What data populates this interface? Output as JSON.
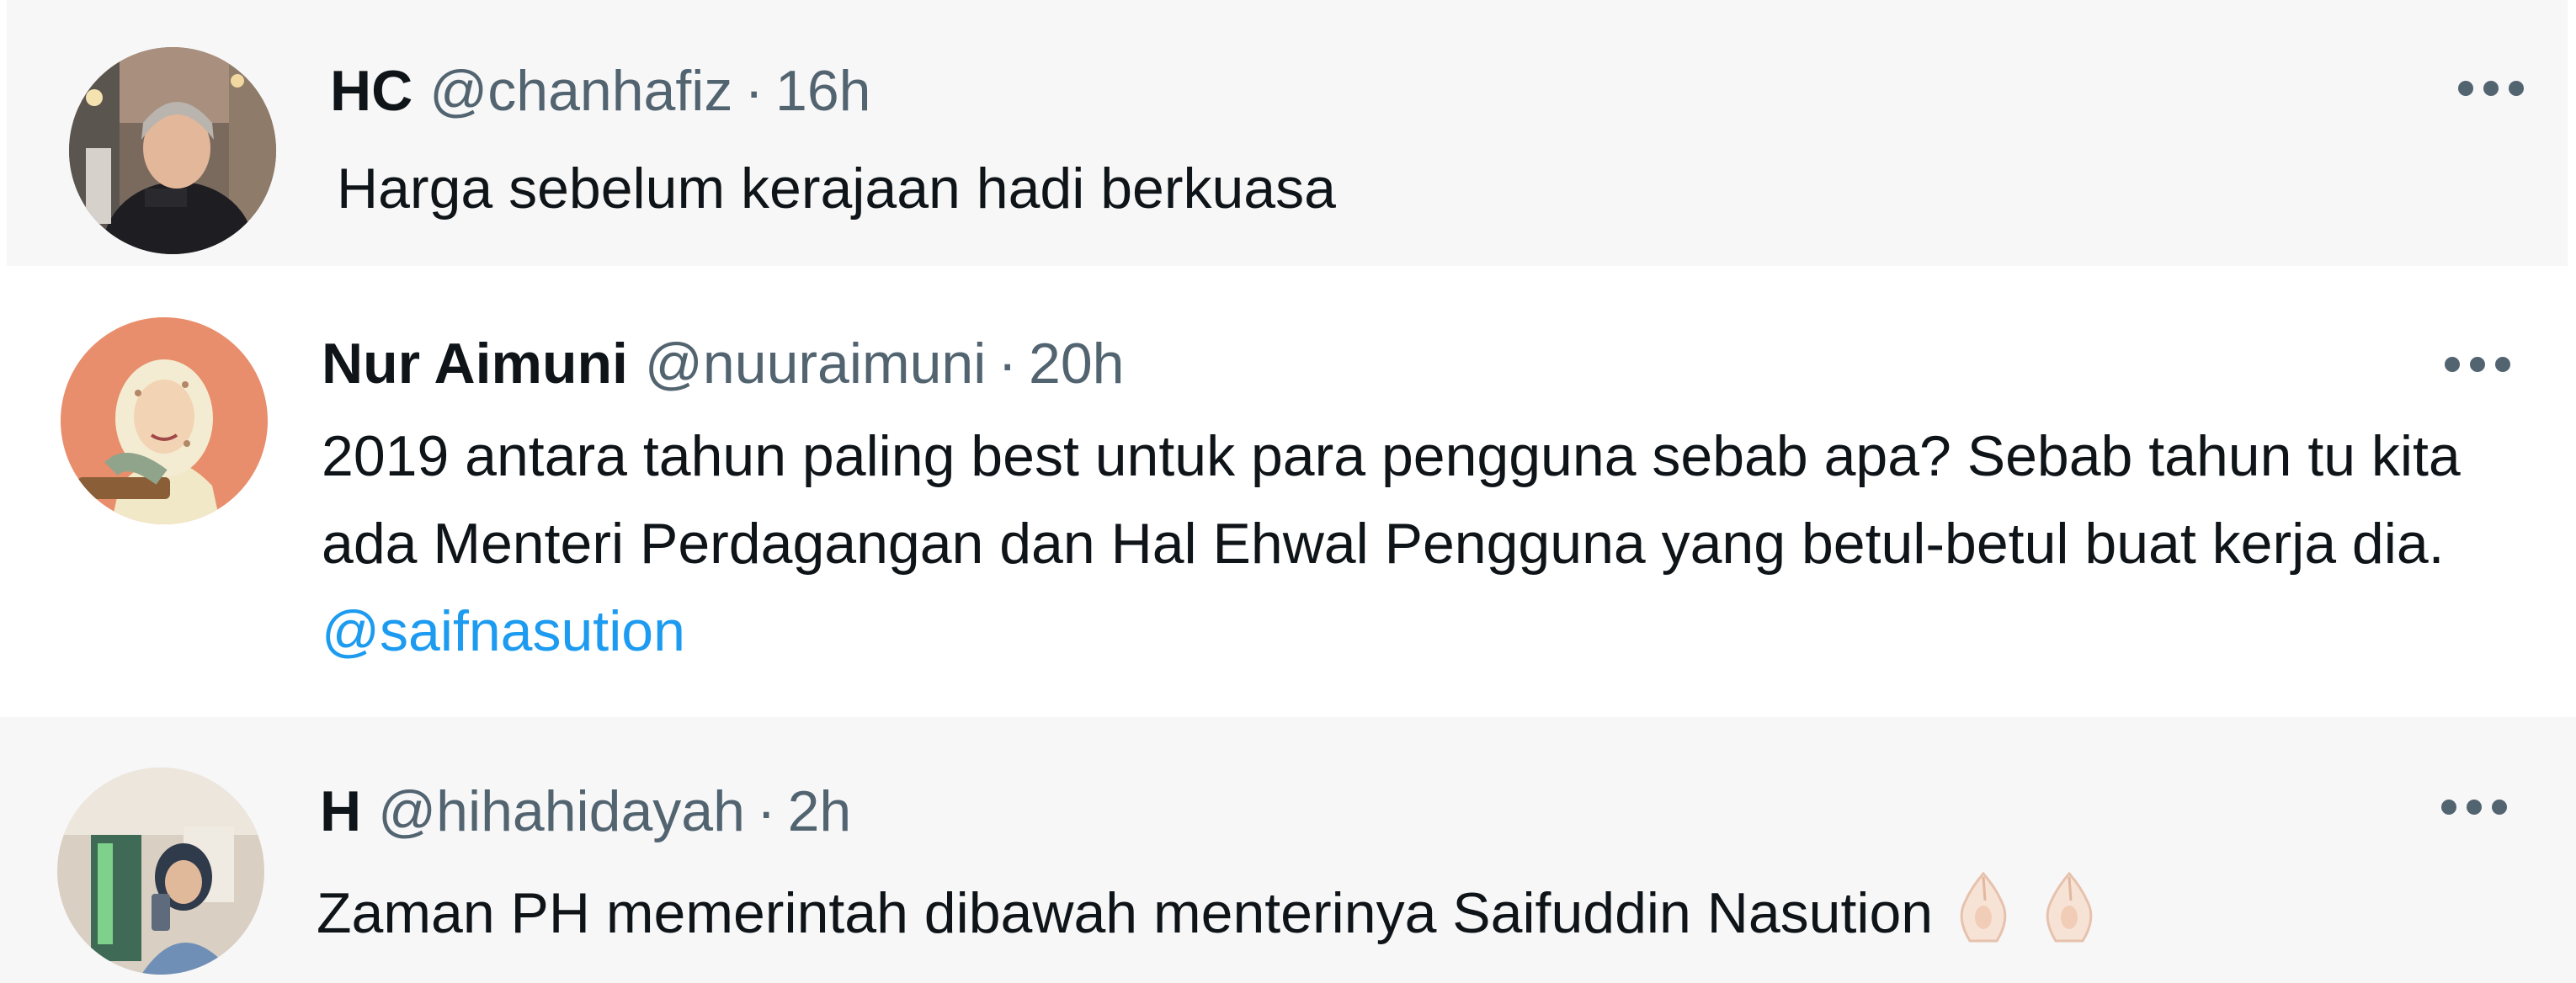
{
  "tweets": [
    {
      "name": "HC",
      "handle": "@chanhafiz",
      "separator": "·",
      "time": "16h",
      "text": "Harga sebelum kerajaan hadi berkuasa"
    },
    {
      "name": "Nur Aimuni",
      "handle": "@nuuraimuni",
      "separator": "·",
      "time": "20h",
      "text": "2019 antara tahun paling best untuk para pengguna sebab apa? Sebab tahun tu kita ada Menteri Perdagangan dan Hal Ehwal Pengguna yang betul-betul buat kerja dia. ",
      "mention": "@saifnasution"
    },
    {
      "name": "H",
      "handle": "@hihahidayah",
      "separator": "·",
      "time": "2h",
      "text": "Zaman PH memerintah dibawah menterinya Saifuddin Nasution",
      "emoji": "pinched-fingers-icon ×2"
    }
  ]
}
